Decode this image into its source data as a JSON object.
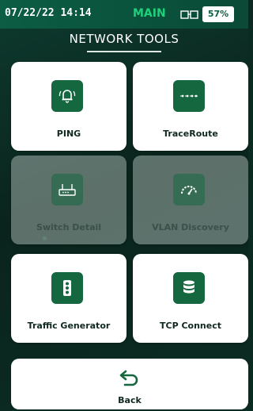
{
  "status": {
    "datetime": "07/22/22 14:14",
    "mode": "MAIN",
    "battery": "57%"
  },
  "header": {
    "title": "NETWORK TOOLS"
  },
  "tiles": [
    {
      "label": "PING",
      "icon": "bell-ping-icon",
      "enabled": true
    },
    {
      "label": "TraceRoute",
      "icon": "traceroute-icon",
      "enabled": true
    },
    {
      "label": "Switch Detail",
      "icon": "switch-icon",
      "enabled": false
    },
    {
      "label": "VLAN Discovery",
      "icon": "gauge-icon",
      "enabled": false
    },
    {
      "label": "Traffic Generator",
      "icon": "traffic-light-icon",
      "enabled": true
    },
    {
      "label": "TCP Connect",
      "icon": "database-icon",
      "enabled": true
    }
  ],
  "back": {
    "label": "Back",
    "icon": "back-arrow-icon"
  },
  "colors": {
    "accent": "#14673f",
    "status_mode": "#1fd17a",
    "background": "#0b2a22"
  }
}
